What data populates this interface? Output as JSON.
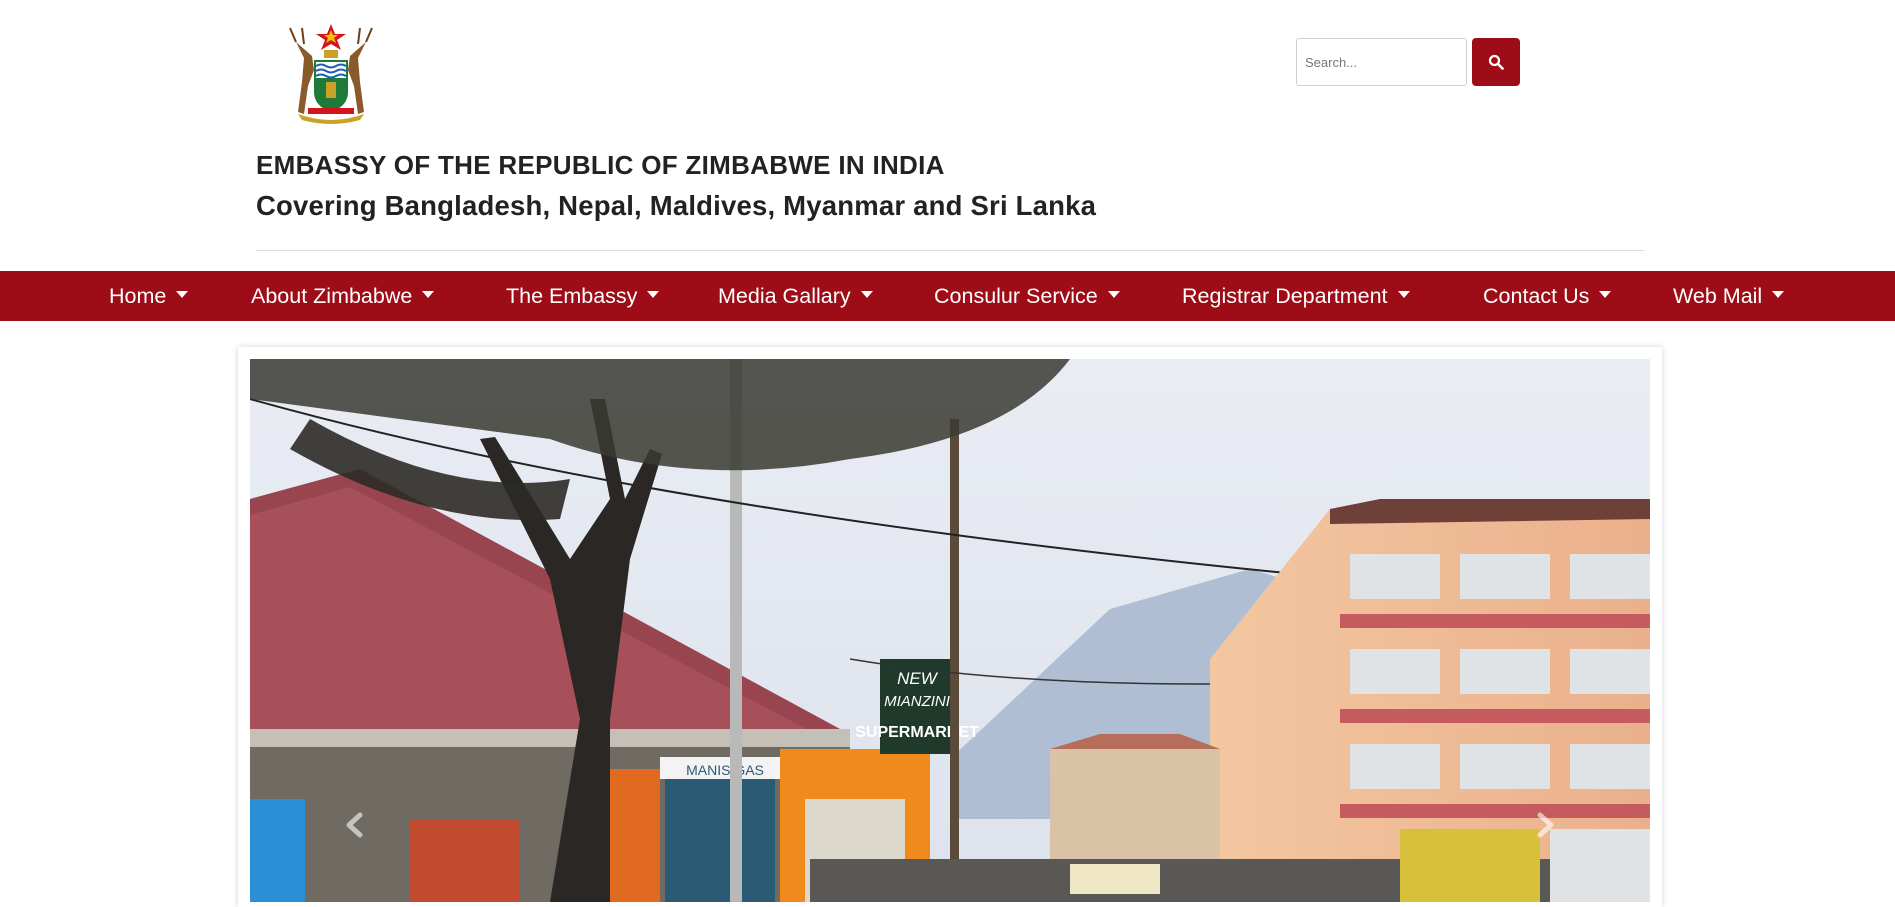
{
  "header": {
    "title": "EMBASSY OF THE REPUBLIC OF ZIMBABWE IN INDIA",
    "subtitle": "Covering Bangladesh, Nepal, Maldives, Myanmar and Sri Lanka",
    "logo_icon": "zimbabwe-coat-of-arms"
  },
  "search": {
    "placeholder": "Search...",
    "value": "",
    "button_icon": "search-icon"
  },
  "nav": {
    "items": [
      {
        "label": "Home"
      },
      {
        "label": "About Zimbabwe"
      },
      {
        "label": "The Embassy"
      },
      {
        "label": "Media Gallary"
      },
      {
        "label": "Consulur Service"
      },
      {
        "label": "Registrar Department"
      },
      {
        "label": "Contact Us"
      },
      {
        "label": "Web Mail"
      }
    ]
  },
  "carousel": {
    "prev_icon": "chevron-left-icon",
    "next_icon": "chevron-right-icon",
    "sign_text": [
      "NEW",
      "MIANZINI",
      "SUPERMARKET"
    ],
    "gas_sign": "MANIS GAS"
  },
  "colors": {
    "brand": "#9e0c18",
    "text": "#222222",
    "background": "#ffffff"
  }
}
